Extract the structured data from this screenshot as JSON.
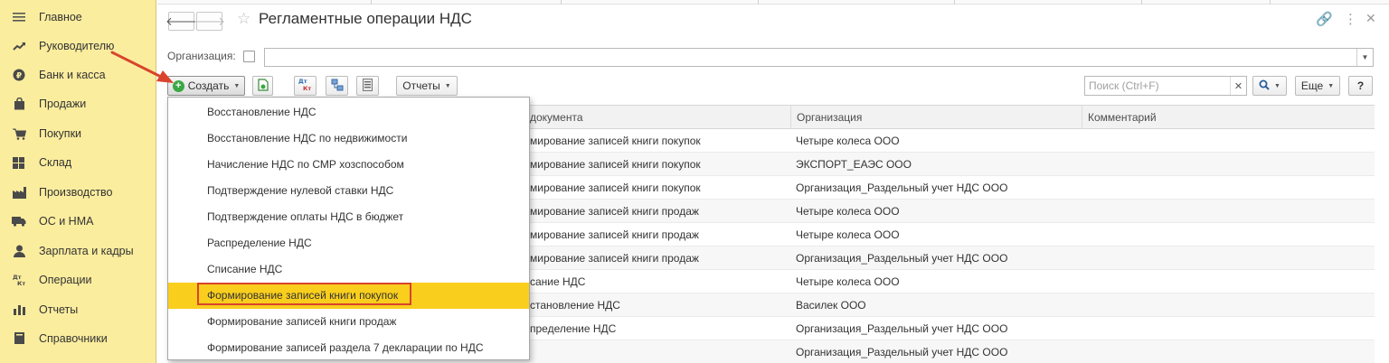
{
  "sidebar": {
    "items": [
      {
        "label": "Главное",
        "icon": "menu-icon"
      },
      {
        "label": "Руководителю",
        "icon": "trend-icon"
      },
      {
        "label": "Банк и касса",
        "icon": "coin-icon"
      },
      {
        "label": "Продажи",
        "icon": "bag-icon"
      },
      {
        "label": "Покупки",
        "icon": "cart-icon"
      },
      {
        "label": "Склад",
        "icon": "warehouse-icon"
      },
      {
        "label": "Производство",
        "icon": "factory-icon"
      },
      {
        "label": "ОС и НМА",
        "icon": "truck-icon"
      },
      {
        "label": "Зарплата и кадры",
        "icon": "person-icon"
      },
      {
        "label": "Операции",
        "icon": "dt-kt-icon"
      },
      {
        "label": "Отчеты",
        "icon": "bar-chart-icon"
      },
      {
        "label": "Справочники",
        "icon": "book-icon"
      }
    ]
  },
  "header": {
    "title": "Регламентные операции НДС",
    "back_glyph": "🡐",
    "forward_glyph": "🡒",
    "star_glyph": "☆",
    "link_glyph": "🔗",
    "more_glyph": "⋮",
    "close_glyph": "✕"
  },
  "filter": {
    "org_label": "Организация:",
    "org_value": ""
  },
  "toolbar": {
    "create_label": "Создать",
    "reports_label": "Отчеты",
    "search_placeholder": "Поиск (Ctrl+F)",
    "more_label": "Еще",
    "help_label": "?",
    "dt_kt_label": "Дт Кт"
  },
  "table": {
    "columns": [
      "документа",
      "Организация",
      "Комментарий"
    ],
    "rows": [
      {
        "doc": "мирование записей книги покупок",
        "org": "Четыре колеса ООО",
        "comment": ""
      },
      {
        "doc": "мирование записей книги покупок",
        "org": "ЭКСПОРТ_ЕАЭС ООО",
        "comment": ""
      },
      {
        "doc": "мирование записей книги покупок",
        "org": "Организация_Раздельный учет НДС ООО",
        "comment": ""
      },
      {
        "doc": "мирование записей книги продаж",
        "org": "Четыре колеса ООО",
        "comment": ""
      },
      {
        "doc": "мирование записей книги продаж",
        "org": "Четыре колеса ООО",
        "comment": ""
      },
      {
        "doc": "мирование записей книги продаж",
        "org": "Организация_Раздельный учет НДС ООО",
        "comment": ""
      },
      {
        "doc": "сание НДС",
        "org": "Четыре колеса ООО",
        "comment": ""
      },
      {
        "doc": "становление НДС",
        "org": "Василек ООО",
        "comment": ""
      },
      {
        "doc": "пределение НДС",
        "org": "Организация_Раздельный учет НДС ООО",
        "comment": ""
      },
      {
        "doc": "",
        "org": "Организация_Раздельный учет НДС ООО",
        "comment": ""
      }
    ]
  },
  "menu": {
    "items": [
      "Восстановление НДС",
      "Восстановление НДС по недвижимости",
      "Начисление НДС по СМР хозспособом",
      "Подтверждение нулевой ставки НДС",
      "Подтверждение оплаты НДС в бюджет",
      "Распределение НДС",
      "Списание НДС",
      "Формирование записей книги покупок",
      "Формирование записей книги продаж",
      "Формирование записей раздела 7 декларации по НДС"
    ],
    "selected_index": 7
  },
  "colors": {
    "sidebar_bg": "#fbed9e",
    "selection": "#f9ce1d",
    "highlight_border": "#d9442c",
    "arrow": "#d9442c",
    "create_icon": "#3aa845"
  }
}
